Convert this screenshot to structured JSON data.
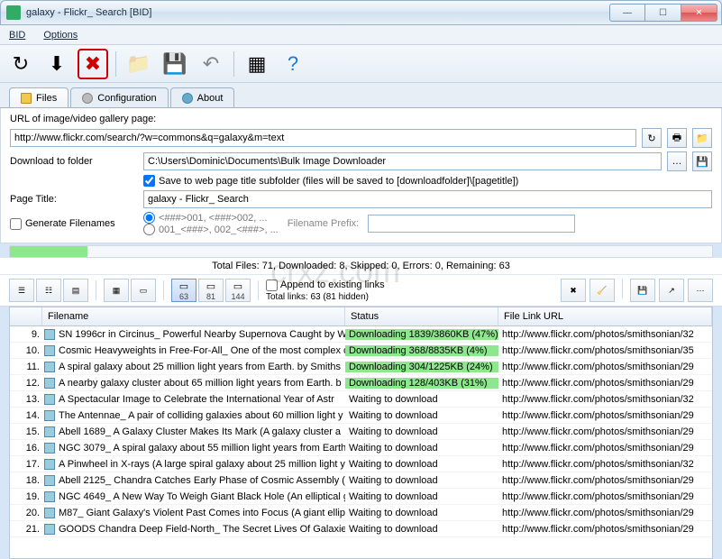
{
  "window": {
    "title": "galaxy - Flickr_ Search [BID]"
  },
  "menu": {
    "bid": "BID",
    "options": "Options"
  },
  "tabs": {
    "files": "Files",
    "config": "Configuration",
    "about": "About"
  },
  "form": {
    "url_label": "URL of image/video gallery page:",
    "url_value": "http://www.flickr.com/search/?w=commons&q=galaxy&m=text",
    "dl_label": "Download to folder",
    "dl_value": "C:\\Users\\Dominic\\Documents\\Bulk Image Downloader",
    "save_sub": "Save to web page title subfolder (files will be saved to [downloadfolder]\\[pagetitle])",
    "pt_label": "Page Title:",
    "pt_value": "galaxy - Flickr_ Search",
    "gen_fn": "Generate Filenames",
    "radio1": "<###>001, <###>002, ...",
    "radio2": "001_<###>, 002_<###>, ...",
    "prefix_label": "Filename Prefix:"
  },
  "status": {
    "line": "Total Files: 71, Downloaded: 8, Skipped: 0, Errors: 0, Remaining: 63",
    "append": "Append to existing links",
    "links": "Total links: 63 (81 hidden)",
    "v63": "63",
    "v81": "81",
    "v144": "144"
  },
  "columns": {
    "fn": "Filename",
    "st": "Status",
    "url": "File Link URL"
  },
  "rows": [
    {
      "n": "9.",
      "fn": "SN 1996cr in Circinus_ Powerful Nearby Supernova Caught by W",
      "st": "Downloading 1839/3860KB (47%)",
      "dl": true,
      "url": "http://www.flickr.com/photos/smithsonian/32"
    },
    {
      "n": "10.",
      "fn": "Cosmic Heavyweights in Free-For-All_ One of the most complex c",
      "st": "Downloading 368/8835KB (4%)",
      "dl": true,
      "url": "http://www.flickr.com/photos/smithsonian/35"
    },
    {
      "n": "11.",
      "fn": "A spiral galaxy about 25 million light years from Earth. by Smiths",
      "st": "Downloading 304/1225KB (24%)",
      "dl": true,
      "url": "http://www.flickr.com/photos/smithsonian/29"
    },
    {
      "n": "12.",
      "fn": "A nearby galaxy cluster about 65 million light years from Earth. b",
      "st": "Downloading 128/403KB (31%)",
      "dl": true,
      "url": "http://www.flickr.com/photos/smithsonian/29"
    },
    {
      "n": "13.",
      "fn": "A Spectacular Image to Celebrate the International Year of Astr",
      "st": "Waiting to download",
      "dl": false,
      "url": "http://www.flickr.com/photos/smithsonian/32"
    },
    {
      "n": "14.",
      "fn": "The Antennae_ A pair of colliding galaxies about 60 million light y",
      "st": "Waiting to download",
      "dl": false,
      "url": "http://www.flickr.com/photos/smithsonian/29"
    },
    {
      "n": "15.",
      "fn": "Abell 1689_ A Galaxy Cluster Makes Its Mark (A galaxy cluster a",
      "st": "Waiting to download",
      "dl": false,
      "url": "http://www.flickr.com/photos/smithsonian/29"
    },
    {
      "n": "16.",
      "fn": "NGC 3079_ A spiral galaxy about 55 million light years from Earth",
      "st": "Waiting to download",
      "dl": false,
      "url": "http://www.flickr.com/photos/smithsonian/29"
    },
    {
      "n": "17.",
      "fn": "A Pinwheel in X-rays (A large spiral galaxy about 25 million light y",
      "st": "Waiting to download",
      "dl": false,
      "url": "http://www.flickr.com/photos/smithsonian/32"
    },
    {
      "n": "18.",
      "fn": "Abell 2125_ Chandra Catches Early Phase of Cosmic Assembly (A",
      "st": "Waiting to download",
      "dl": false,
      "url": "http://www.flickr.com/photos/smithsonian/29"
    },
    {
      "n": "19.",
      "fn": "NGC 4649_ A New Way To Weigh Giant Black Hole (An elliptical g",
      "st": "Waiting to download",
      "dl": false,
      "url": "http://www.flickr.com/photos/smithsonian/29"
    },
    {
      "n": "20.",
      "fn": "M87_ Giant Galaxy's Violent Past Comes into Focus (A giant ellipt",
      "st": "Waiting to download",
      "dl": false,
      "url": "http://www.flickr.com/photos/smithsonian/29"
    },
    {
      "n": "21.",
      "fn": "GOODS Chandra Deep Field-North_ The Secret Lives Of Galaxies",
      "st": "Waiting to download",
      "dl": false,
      "url": "http://www.flickr.com/photos/smithsonian/29"
    }
  ]
}
